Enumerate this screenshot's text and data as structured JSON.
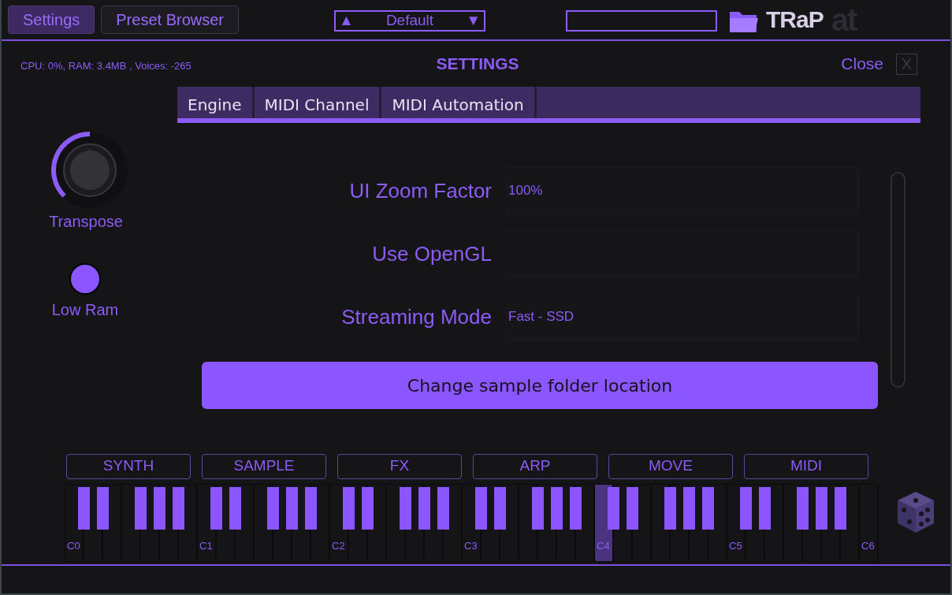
{
  "top_tabs": [
    {
      "label": "Settings",
      "selected": true
    },
    {
      "label": "Preset Browser",
      "selected": false
    }
  ],
  "preset": {
    "prev": "▲",
    "name": "Default",
    "next": "▼"
  },
  "logos": {
    "brand": "TRaP",
    "maker": "at"
  },
  "status": "CPU: 0%, RAM: 3.4MB , Voices: -265",
  "title": "SETTINGS",
  "close": {
    "label": "Close",
    "icon": "X"
  },
  "settings_tabs": [
    {
      "label": "Engine"
    },
    {
      "label": "MIDI Channel"
    },
    {
      "label": "MIDI Automation"
    }
  ],
  "side_controls": [
    {
      "kind": "knob",
      "label": "Transpose",
      "level": 0.5
    },
    {
      "kind": "toggle",
      "label": "Low Ram",
      "on": true
    }
  ],
  "settings": [
    {
      "label": "UI Zoom Factor",
      "value": "100%"
    },
    {
      "label": "Use OpenGL"
    },
    {
      "label": "Streaming Mode",
      "value": "Fast - SSD"
    }
  ],
  "action_button": "Change sample folder location",
  "categories": [
    "SYNTH",
    "SAMPLE",
    "FX",
    "ARP",
    "MOVE",
    "MIDI"
  ],
  "octaves": [
    {
      "label": "C0",
      "pressed": false
    },
    {
      "label": "C1",
      "pressed": false
    },
    {
      "label": "C2",
      "pressed": false
    },
    {
      "label": "C3",
      "pressed": false
    },
    {
      "label": "C4",
      "pressed": true
    },
    {
      "label": "C5",
      "pressed": false
    },
    {
      "label": "C6",
      "pressed": false
    }
  ]
}
